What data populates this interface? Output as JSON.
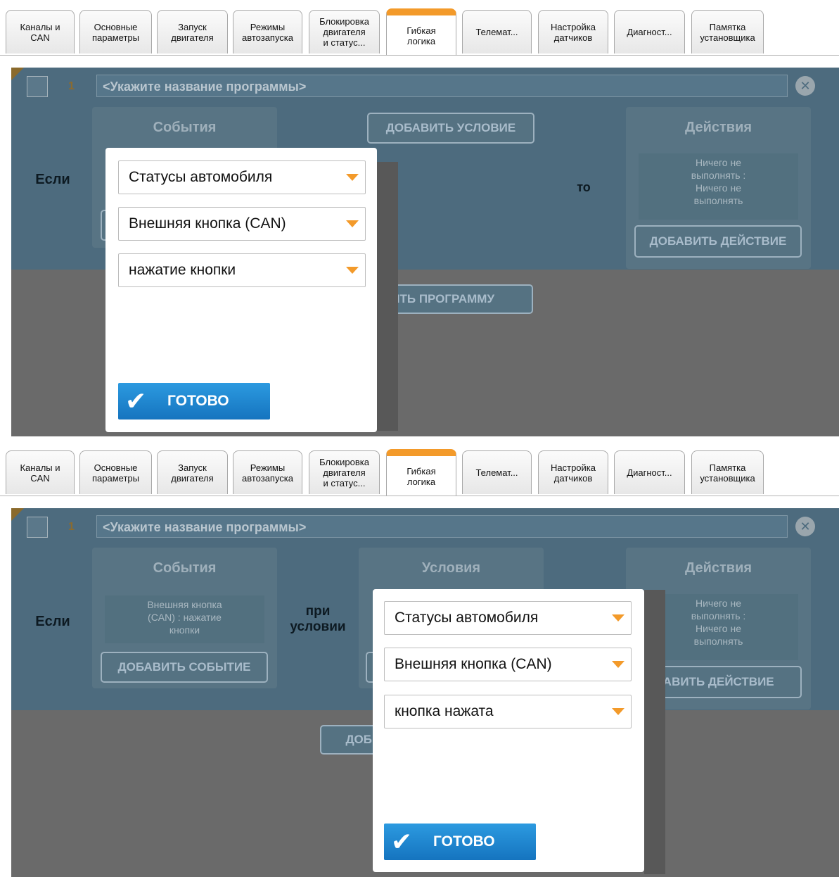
{
  "tabs": [
    {
      "label": "Каналы и\nCAN"
    },
    {
      "label": "Основные\nпараметры"
    },
    {
      "label": "Запуск\nдвигателя"
    },
    {
      "label": "Режимы\nавтозапуска"
    },
    {
      "label": "Блокировка\nдвигателя\nи статус..."
    },
    {
      "label": "Гибкая\nлогика"
    },
    {
      "label": "Телемат..."
    },
    {
      "label": "Настройка\nдатчиков"
    },
    {
      "label": "Диагност..."
    },
    {
      "label": "Памятка\nустановщика"
    }
  ],
  "active_tab": "Гибкая логика",
  "accent_color": "#f39a2a",
  "program": {
    "number": "1",
    "name_placeholder": "<Укажите название программы>",
    "close_icon": "close-circle-icon"
  },
  "panel1": {
    "if_label": "Если",
    "then_label": "то",
    "events_header": "События",
    "actions_header": "Действия",
    "actions_text": "Ничего не\nвыполнять :\nНичего не\nвыполнять",
    "add_condition": "ДОБАВИТЬ УСЛОВИЕ",
    "add_action": "ДОБАВИТЬ ДЕЙСТВИЕ",
    "add_program_partial": "ВИТЬ ПРОГРАММУ",
    "dialog": {
      "select1": "Статусы автомобиля",
      "select2": "Внешняя кнопка (CAN)",
      "select3": "нажатие кнопки",
      "done": "ГОТОВО"
    }
  },
  "panel2": {
    "if_label": "Если",
    "cond_label": "при\nусловии",
    "events_header": "События",
    "conditions_header": "Условия",
    "actions_header": "Действия",
    "events_text": "Внешняя кнопка\n(CAN) : нажатие\nкнопки",
    "actions_text": "Ничего не\nвыполнять :\nНичего не\nвыполнять",
    "add_event": "ДОБАВИТЬ СОБЫТИЕ",
    "add_action": "ДОБАВИТЬ ДЕЙСТВИЕ",
    "add_action_partial": "ОБАВИТЬ ДЕЙСТВИЕ",
    "add_program_partial": "ДОБ",
    "dialog": {
      "select1": "Статусы автомобиля",
      "select2": "Внешняя кнопка (CAN)",
      "select3": "кнопка нажата",
      "done": "ГОТОВО"
    }
  }
}
